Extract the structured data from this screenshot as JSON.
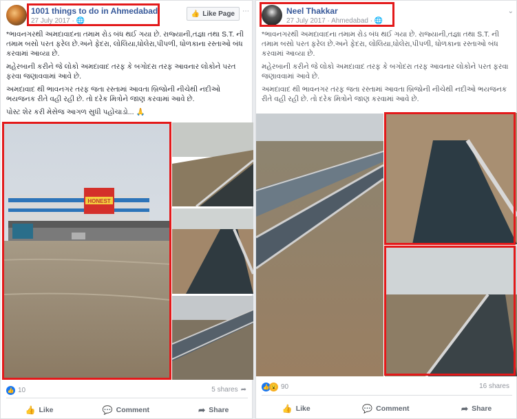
{
  "left_post": {
    "page_name": "1001 things to do in Ahmedabad",
    "date": "27 July 2017",
    "like_page_label": "Like Page",
    "paragraphs": [
      "*ભાવનગરથી અમદાવાદના તમામ રોડ બંધ થઈ ગયા છે. રાજ્યાની,તજ્ઞા તથા S.T. ની તમામ બસો પરત ફરેલ છે.અને ફેદરા, લોલિયા,ધોલેરા,પીપળી, ધોળકાના રસ્તાઓ બંધ કરવામાં આવ્યા છે.",
      "મહેરબાની કરીને જે લોકો અમદાવાદ તરફ કે બગોદરા તરફ આવનાર લોકોને પરત ફરવા જણાવવામાં આવે છે.",
      "અમદાવાદ થી ભાવનગર તરફ જતા રસ્તામાં આવતા બ્રિજોની નીચેથી નદીઓ ભયજનક રીતે વહી રહી છે. તો દરેક મિત્રોને જાણ કરવામાં આવે છે.",
      "પોસ્ટ શેર કરી મેસેજ આગળ સુધી પહોંચાડો..."
    ],
    "reaction_count": "10",
    "shares": "5 shares",
    "actions": {
      "like": "Like",
      "comment": "Comment",
      "share": "Share"
    },
    "storefront_sign": "HONEST"
  },
  "right_post": {
    "user_name": "Neel Thakkar",
    "date": "27 July 2017",
    "location": "Ahmedabad",
    "paragraphs": [
      "*ભાવનગરથી અમદાવાદના તમામ રોડ બંધ થઈ ગયા છે. રાજ્યાની,તજ્ઞા તથા S.T. ની તમામ બસો પરત ફરેલ છે.અને ફેદરા, લોલિયા,ધોલેરા,પીપળી, ધોળકાના રસ્તાઓ બંધ કરવામાં આવ્યા છે.",
      "મહેરબાની કરીને જે લોકો અમદાવાદ તરફ કે બગોદરા તરફ આવનાર લોકોને પરત ફરવા જણાવવામાં આવે છે.",
      "અમદાવાદ થી ભાવનગર તરફ જતા રસ્તામાં આવતા બ્રિજોની નીચેથી નદીઓ ભયજનક રીતે વહી રહી છે. તો દરેક મિત્રોને જાણ કરવામાં આવે છે."
    ],
    "reaction_count": "90",
    "shares": "16 shares",
    "actions": {
      "like": "Like",
      "comment": "Comment",
      "share": "Share"
    }
  },
  "colors": {
    "highlight": "#e3191a",
    "link": "#365899",
    "like_blue": "#1877f2",
    "love_red": "#f33e58",
    "wow_yellow": "#f7b125"
  },
  "icons": [
    "globe-icon",
    "like-thumb-icon",
    "comment-bubble-icon",
    "share-arrow-icon",
    "chevron-down-icon",
    "pray-emoji-icon"
  ]
}
